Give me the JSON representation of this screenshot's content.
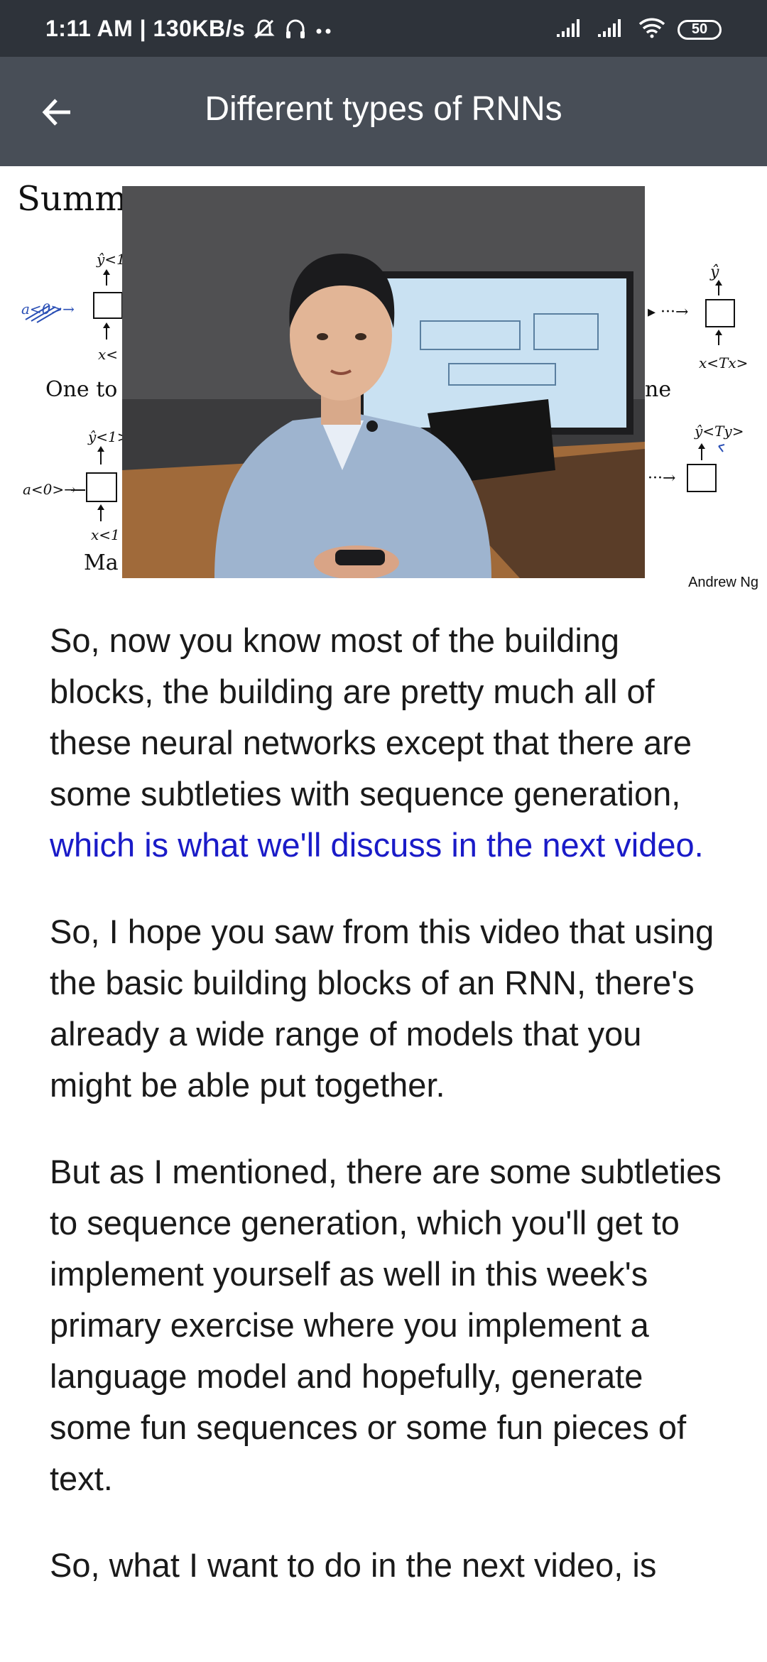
{
  "status_bar": {
    "time_and_speed": "1:11 AM | 130KB/s",
    "battery_level": "50",
    "icons": [
      "alarm-off-icon",
      "headset-icon",
      "more-dots-icon",
      "signal-icon",
      "signal-icon",
      "wifi-icon",
      "battery-icon"
    ]
  },
  "app_bar": {
    "title": "Different types of RNNs",
    "back_icon": "arrow-left-icon"
  },
  "video": {
    "slide_title": "Summ",
    "slide_credit": "Andrew Ng",
    "diagram_labels": {
      "one_to_one_left": "One to",
      "one_to_one_right": "ne",
      "many_left": "Ma"
    }
  },
  "transcript": {
    "p1_plain": "So, now you know most of the building blocks, the building are pretty much all of these neural networks except that there are some subtleties with sequence generation, ",
    "p1_highlight": "which is what we'll discuss in the next video.",
    "p2": "So, I hope you saw from this video that using the basic building blocks of an RNN, there's already a wide range of models that you might be able put together.",
    "p3": "But as I mentioned, there are some subtleties to sequence generation, which you'll get to implement yourself as well in this week's primary exercise where you implement a language model and hopefully, generate some fun sequences or some fun pieces of text.",
    "p4": "So, what I want to do in the next video, is"
  },
  "colors": {
    "status_bar": "#2e333a",
    "app_bar": "#484e57",
    "highlight_text": "#1a1bc8",
    "body_text": "#1a1a1a"
  }
}
